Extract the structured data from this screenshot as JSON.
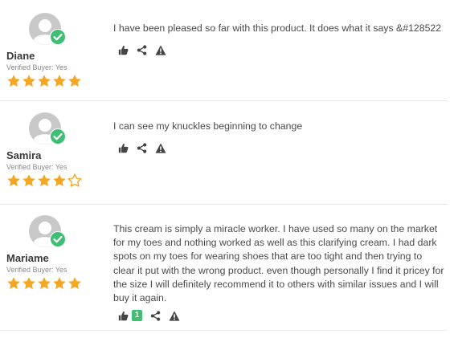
{
  "colors": {
    "star": "#f5a623",
    "verified_check": "#3fbf73",
    "avatar": "#c8c8c8",
    "icon": "#444444"
  },
  "reviews": [
    {
      "name": "Diane",
      "verified_label": "Verified Buyer: Yes",
      "rating": 5,
      "text": "I have been pleased so far with  this product. It does what it says &#128522",
      "helpful_count": ""
    },
    {
      "name": "Samira",
      "verified_label": "Verified Buyer: Yes",
      "rating": 4,
      "text": "I can see my knuckles beginning to change",
      "helpful_count": ""
    },
    {
      "name": "Mariame",
      "verified_label": "Verified Buyer: Yes",
      "rating": 5,
      "text": "This cream is simply a miracle worker. I have used so many on the market for my toes and nothing worked as well as this clarifying cream. I had dark spots on my toes for wearing shoes that are too tight and then trying to clear it put with the wrong product.  even though personally I find it pricey for the size I will definitely recommend it to others with similar issues and I will buy it again.",
      "helpful_count": "1"
    }
  ],
  "icons": [
    "thumbs-up-icon",
    "share-icon",
    "report-icon",
    "avatar-icon",
    "verified-check-icon",
    "star-icon"
  ]
}
